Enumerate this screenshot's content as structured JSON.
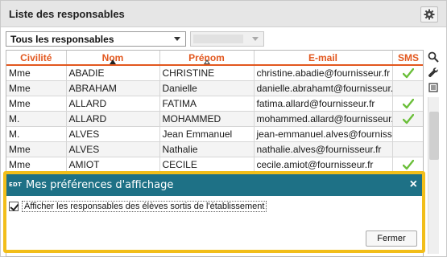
{
  "header": {
    "title": "Liste des responsables"
  },
  "filters": {
    "selected": "Tous les responsables",
    "secondary_value": ""
  },
  "table": {
    "columns": [
      {
        "label": "Civilité",
        "sort": ""
      },
      {
        "label": "Nom",
        "sort": "asc"
      },
      {
        "label": "Prénom",
        "sort": "hollow"
      },
      {
        "label": "E-mail",
        "sort": ""
      },
      {
        "label": "SMS",
        "sort": ""
      }
    ],
    "rows": [
      {
        "civilite": "Mme",
        "nom": "ABADIE",
        "prenom": "CHRISTINE",
        "email": "christine.abadie@fournisseur.fr",
        "sms": true
      },
      {
        "civilite": "Mme",
        "nom": "ABRAHAM",
        "prenom": "Danielle",
        "email": "danielle.abrahamt@fournisseur.fr",
        "sms": false
      },
      {
        "civilite": "Mme",
        "nom": "ALLARD",
        "prenom": "FATIMA",
        "email": "fatima.allard@fournisseur.fr",
        "sms": true
      },
      {
        "civilite": "M.",
        "nom": "ALLARD",
        "prenom": "MOHAMMED",
        "email": "mohammed.allard@fournisseur.fr",
        "sms": true
      },
      {
        "civilite": "M.",
        "nom": "ALVES",
        "prenom": "Jean Emmanuel",
        "email": "jean-emmanuel.alves@fournisseu",
        "sms": false
      },
      {
        "civilite": "Mme",
        "nom": "ALVES",
        "prenom": "Nathalie",
        "email": "nathalie.alves@fournisseur.fr",
        "sms": false
      },
      {
        "civilite": "Mme",
        "nom": "AMIOT",
        "prenom": "CECILE",
        "email": "cecile.amiot@fournisseur.fr",
        "sms": true
      },
      {
        "civilite": "",
        "nom": "",
        "prenom": "",
        "email": "",
        "sms": false
      },
      {
        "civilite": "",
        "nom": "",
        "prenom": "",
        "email": "",
        "sms": false
      },
      {
        "civilite": "",
        "nom": "",
        "prenom": "",
        "email": "",
        "sms": false
      },
      {
        "civilite": "",
        "nom": "",
        "prenom": "",
        "email": "",
        "sms": false
      },
      {
        "civilite": "",
        "nom": "",
        "prenom": "",
        "email": "",
        "sms": false
      }
    ]
  },
  "dialog": {
    "badge": "EDT",
    "title": "Mes préférences d'affichage",
    "close_label": "×",
    "option_label": "Afficher les responsables des élèves sortis de l'établissement",
    "option_checked": true,
    "close_button_label": "Fermer"
  },
  "icons": [
    "gear-icon",
    "search-icon",
    "wrench-icon",
    "list-icon",
    "copy-icon",
    "check-icon"
  ],
  "colors": {
    "accent": "#e2571e",
    "dialog_header": "#1e7186",
    "highlight": "#f2be1a",
    "check": "#6bbf3a"
  }
}
